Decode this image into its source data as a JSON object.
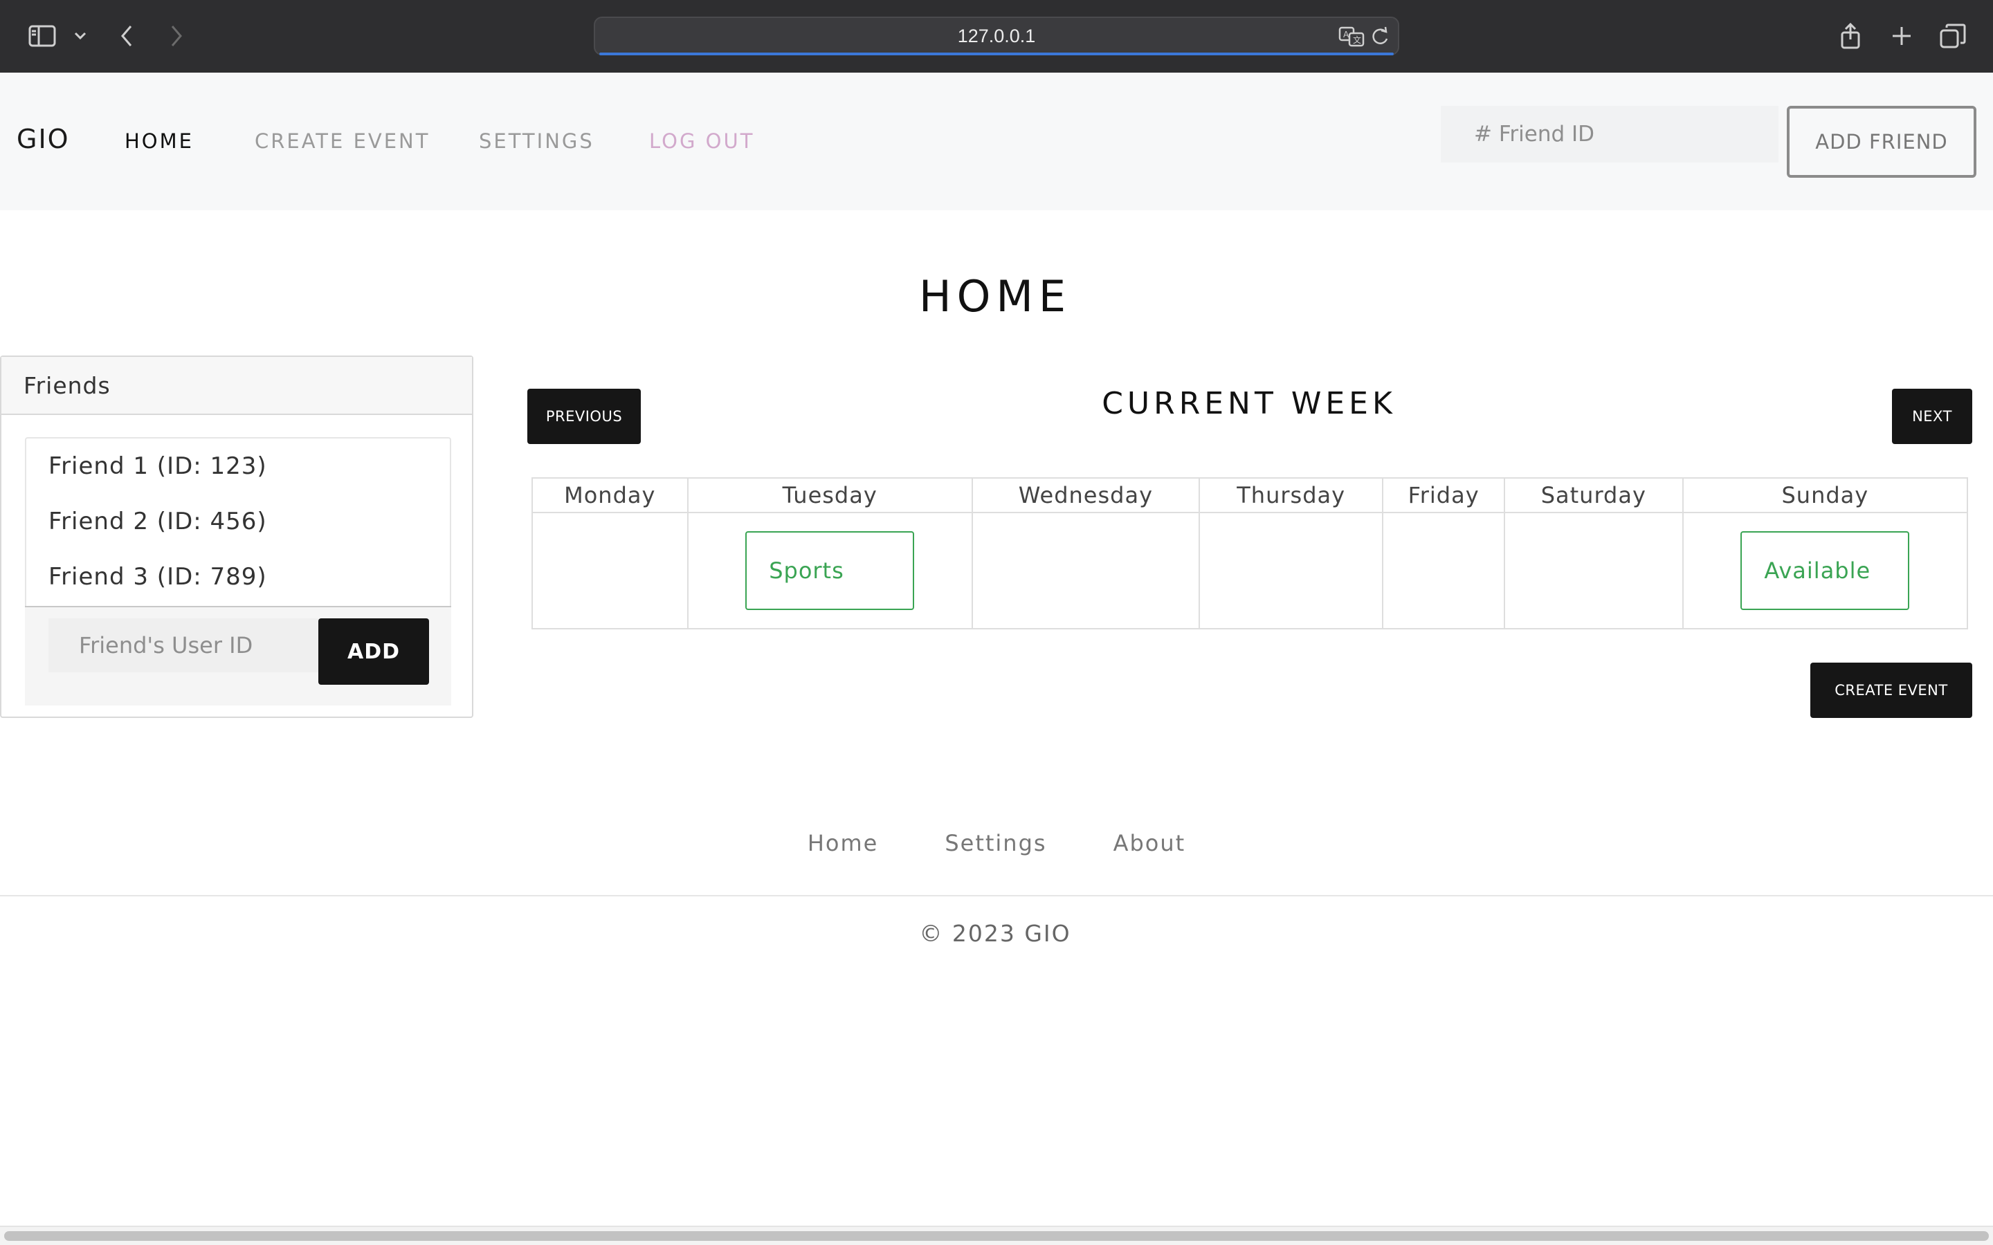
{
  "browser": {
    "url": "127.0.0.1",
    "icons": [
      "sidebar-icon",
      "chevron-down-icon",
      "back-icon",
      "forward-icon",
      "translate-icon",
      "reload-icon",
      "share-icon",
      "new-tab-icon",
      "tab-overview-icon"
    ]
  },
  "navbar": {
    "brand": "GIO",
    "links": [
      {
        "label": "HOME"
      },
      {
        "label": "CREATE EVENT"
      },
      {
        "label": "SETTINGS"
      },
      {
        "label": "LOG OUT"
      }
    ],
    "friend_id_placeholder": "# Friend ID",
    "add_friend_label": "ADD FRIEND"
  },
  "page": {
    "title": "HOME"
  },
  "friends": {
    "heading": "Friends",
    "items": [
      {
        "label": "Friend 1 (ID: 123)"
      },
      {
        "label": "Friend 2 (ID: 456)"
      },
      {
        "label": "Friend 3 (ID: 789)"
      }
    ],
    "input_placeholder": "Friend's User ID",
    "add_label": "ADD"
  },
  "calendar": {
    "title": "CURRENT WEEK",
    "previous_label": "PREVIOUS",
    "next_label": "NEXT",
    "days": [
      "Monday",
      "Tuesday",
      "Wednesday",
      "Thursday",
      "Friday",
      "Saturday",
      "Sunday"
    ],
    "events": {
      "tuesday": "Sports",
      "sunday": "Available"
    },
    "create_event_label": "CREATE EVENT"
  },
  "footer": {
    "links": [
      {
        "label": "Home"
      },
      {
        "label": "Settings"
      },
      {
        "label": "About"
      }
    ],
    "copyright": "© 2023 GIO"
  },
  "colors": {
    "chrome": "#2e2e30",
    "navbar_bg": "#f7f8f9",
    "button_dark": "#161616",
    "event_green": "#3aa453",
    "logout_pink": "#d2a9cc",
    "url_progress": "#3b78d8"
  }
}
